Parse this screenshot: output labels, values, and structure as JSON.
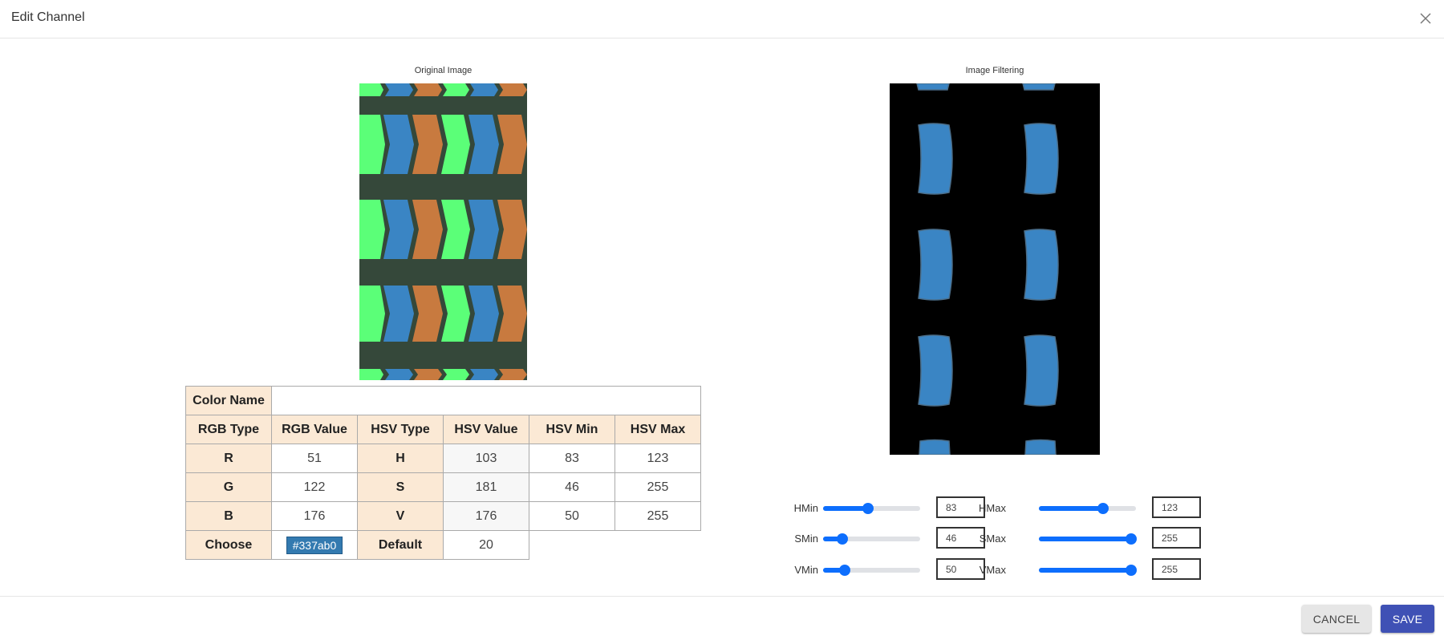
{
  "dialog": {
    "title": "Edit Channel"
  },
  "original": {
    "caption": "Original Image"
  },
  "filtered": {
    "caption": "Image Filtering"
  },
  "table": {
    "color_name_label": "Color Name",
    "color_name_value": "",
    "headers": [
      "RGB Type",
      "RGB Value",
      "HSV Type",
      "HSV Value",
      "HSV Min",
      "HSV Max"
    ],
    "rows": [
      {
        "rgb_type": "R",
        "rgb_value": "51",
        "hsv_type": "H",
        "hsv_value": "103",
        "hsv_min": "83",
        "hsv_max": "123"
      },
      {
        "rgb_type": "G",
        "rgb_value": "122",
        "hsv_type": "S",
        "hsv_value": "181",
        "hsv_min": "46",
        "hsv_max": "255"
      },
      {
        "rgb_type": "B",
        "rgb_value": "176",
        "hsv_type": "V",
        "hsv_value": "176",
        "hsv_min": "50",
        "hsv_max": "255"
      }
    ],
    "choose_label": "Choose",
    "choose_value": "#337ab0",
    "default_label": "Default",
    "default_value": "20"
  },
  "sliders": {
    "hmin": {
      "label": "HMin",
      "value": "83",
      "fraction": 0.46
    },
    "hmax": {
      "label": "HMax",
      "value": "123",
      "fraction": 0.66
    },
    "smin": {
      "label": "SMin",
      "value": "46",
      "fraction": 0.2
    },
    "smax": {
      "label": "SMax",
      "value": "255",
      "fraction": 0.95
    },
    "vmin": {
      "label": "VMin",
      "value": "50",
      "fraction": 0.22
    },
    "vmax": {
      "label": "VMax",
      "value": "255",
      "fraction": 0.95
    }
  },
  "buttons": {
    "cancel": "CANCEL",
    "save": "SAVE"
  },
  "colors": {
    "header_bg": "#fbe9d5",
    "accent": "#0d6efd",
    "save_bg": "#3f51b5",
    "chip": "#337ab0",
    "pixel_green": "#5bff78",
    "pixel_blue": "#3a85c4",
    "pixel_orange": "#c87a3f",
    "grid_dark": "#35483a"
  },
  "icons": {
    "close": "close-icon"
  }
}
